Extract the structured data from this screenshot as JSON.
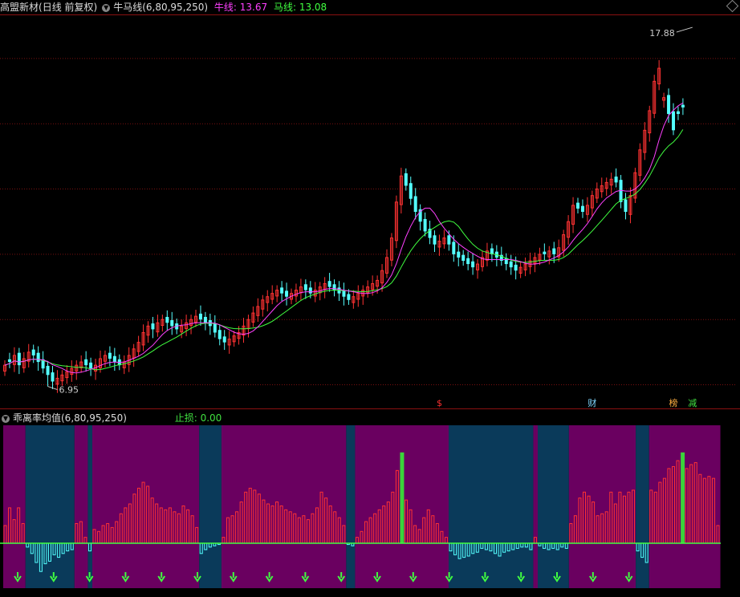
{
  "header": {
    "stock_name": "高盟新材",
    "period": "(日线 前复权)",
    "indicator": "牛马线(6,80,95,250)",
    "niu_label": "牛线: 13.67",
    "ma_label": "马线: 13.08"
  },
  "sub_header": {
    "indicator": "乖离率均值(6,80,95,250)",
    "stop_loss": "止损: 0.00"
  },
  "annotations": {
    "high": "17.88",
    "low": "6.95",
    "events": [
      {
        "text": "$",
        "color": "#ff3030",
        "bar": 91
      },
      {
        "text": "财",
        "color": "#7fd7ff",
        "bar": 123
      },
      {
        "text": "榜",
        "color": "#ffb040",
        "bar": 140
      },
      {
        "text": "减",
        "color": "#40e040",
        "bar": 144
      }
    ]
  },
  "colors": {
    "up": "#ff3232",
    "down": "#54ffff",
    "niu": "#ff40ff",
    "ma": "#40ff40",
    "grid": "#7a1010",
    "bg_purple": "#6a0060",
    "bg_teal": "#0a3a5a"
  },
  "chart_data": [
    {
      "type": "candlestick",
      "series_names": [
        "牛线",
        "马线"
      ],
      "closes": [
        7.6,
        7.7,
        7.9,
        7.6,
        7.8,
        8.0,
        7.9,
        7.7,
        7.5,
        7.3,
        7.1,
        7.2,
        7.3,
        7.4,
        7.5,
        7.6,
        7.7,
        7.6,
        7.5,
        7.6,
        7.8,
        7.9,
        7.8,
        7.7,
        7.6,
        7.7,
        7.9,
        8.1,
        8.3,
        8.6,
        8.8,
        8.7,
        8.9,
        9.0,
        8.9,
        8.8,
        8.7,
        8.8,
        8.9,
        9.0,
        9.1,
        9.0,
        8.9,
        8.8,
        8.6,
        8.4,
        8.3,
        8.4,
        8.5,
        8.6,
        8.8,
        9.0,
        9.2,
        9.4,
        9.6,
        9.7,
        9.8,
        9.9,
        9.8,
        9.7,
        9.8,
        9.9,
        10.0,
        9.9,
        9.8,
        9.9,
        10.0,
        10.1,
        10.0,
        9.9,
        9.8,
        9.7,
        9.6,
        9.7,
        9.8,
        9.9,
        10.0,
        10.1,
        10.2,
        10.5,
        10.9,
        11.5,
        12.6,
        13.4,
        13.1,
        12.7,
        12.3,
        12.0,
        11.7,
        11.5,
        11.3,
        11.4,
        11.5,
        11.3,
        11.0,
        10.9,
        10.8,
        10.7,
        10.6,
        10.7,
        10.9,
        11.1,
        11.0,
        10.9,
        10.8,
        10.7,
        10.6,
        10.5,
        10.6,
        10.7,
        10.8,
        10.9,
        11.0,
        11.0,
        11.1,
        11.0,
        11.2,
        11.6,
        12.0,
        12.5,
        12.4,
        12.3,
        12.5,
        12.8,
        13.0,
        13.1,
        13.2,
        13.3,
        13.2,
        12.6,
        12.3,
        12.8,
        13.5,
        14.2,
        14.8,
        15.4,
        16.3,
        16.7,
        15.8,
        15.3,
        14.8,
        15.3,
        15.5
      ],
      "up": [
        1,
        0,
        1,
        0,
        1,
        1,
        0,
        0,
        0,
        0,
        0,
        1,
        1,
        1,
        1,
        1,
        1,
        0,
        0,
        1,
        1,
        1,
        0,
        0,
        0,
        1,
        1,
        1,
        1,
        1,
        1,
        0,
        1,
        1,
        0,
        0,
        0,
        1,
        1,
        1,
        1,
        0,
        0,
        0,
        0,
        0,
        0,
        1,
        1,
        1,
        1,
        1,
        1,
        1,
        1,
        1,
        1,
        1,
        0,
        0,
        1,
        1,
        1,
        0,
        0,
        1,
        1,
        1,
        0,
        0,
        0,
        0,
        0,
        1,
        1,
        1,
        1,
        1,
        1,
        1,
        1,
        1,
        1,
        1,
        0,
        0,
        0,
        0,
        0,
        0,
        0,
        1,
        1,
        0,
        0,
        0,
        0,
        0,
        0,
        1,
        1,
        1,
        0,
        0,
        0,
        0,
        0,
        0,
        1,
        1,
        1,
        1,
        1,
        0,
        1,
        0,
        1,
        1,
        1,
        1,
        0,
        0,
        1,
        1,
        1,
        1,
        1,
        1,
        0,
        0,
        0,
        1,
        1,
        1,
        1,
        1,
        1,
        1,
        1,
        0,
        0,
        0,
        0,
        1,
        1
      ],
      "high": 17.88,
      "low": 6.95,
      "niu_last": 13.67,
      "ma_last": 13.08
    },
    {
      "type": "bar",
      "series_name": "乖离率均值",
      "values": [
        0.9,
        1.8,
        1.2,
        1.8,
        1.0,
        -0.3,
        -0.8,
        -1.5,
        -2.2,
        -1.6,
        -1.4,
        -0.9,
        -1.1,
        -0.8,
        -0.6,
        -0.5,
        1.0,
        1.1,
        0.3,
        -0.6,
        0.7,
        0.6,
        0.9,
        1.0,
        0.8,
        1.1,
        1.5,
        1.8,
        2.0,
        2.5,
        2.8,
        3.1,
        2.9,
        2.3,
        2.0,
        1.8,
        1.7,
        1.8,
        1.6,
        1.5,
        1.9,
        1.7,
        1.4,
        0.8,
        -0.8,
        -0.5,
        -0.3,
        -0.2,
        -0.1,
        0.3,
        1.3,
        1.4,
        1.6,
        2.1,
        2.6,
        2.8,
        2.7,
        2.5,
        2.2,
        2.0,
        1.9,
        2.1,
        1.9,
        1.7,
        1.6,
        1.5,
        1.3,
        1.4,
        1.2,
        1.5,
        1.8,
        2.6,
        2.3,
        1.9,
        1.6,
        1.3,
        0.9,
        -0.1,
        -0.2,
        0.3,
        0.6,
        1.1,
        1.3,
        1.5,
        1.7,
        1.9,
        2.1,
        2.6,
        3.7,
        4.6,
        2.2,
        1.7,
        0.9,
        0.7,
        1.3,
        1.7,
        1.4,
        1.0,
        0.6,
        0.3,
        -0.6,
        -0.9,
        -1.2,
        -1.1,
        -1.0,
        -0.8,
        -0.7,
        -0.4,
        -0.5,
        -0.6,
        -0.8,
        -1.0,
        -0.7,
        -0.6,
        -0.5,
        -0.4,
        -0.3,
        -0.3,
        -0.5,
        0.3,
        -0.2,
        -0.4,
        -0.5,
        -0.4,
        -0.5,
        -0.3,
        -0.4,
        1.0,
        1.4,
        2.3,
        2.6,
        2.4,
        2.1,
        1.4,
        1.5,
        1.6,
        2.6,
        2.0,
        2.6,
        2.4,
        2.6,
        2.7,
        -0.6,
        -1.1,
        -1.5,
        2.7,
        2.6,
        3.1,
        3.3,
        3.8,
        3.9,
        4.2,
        4.6,
        3.8,
        4.0,
        4.1,
        3.5,
        3.3,
        3.4,
        3.3,
        0.9
      ],
      "ylim": [
        -3.5,
        6
      ]
    }
  ]
}
